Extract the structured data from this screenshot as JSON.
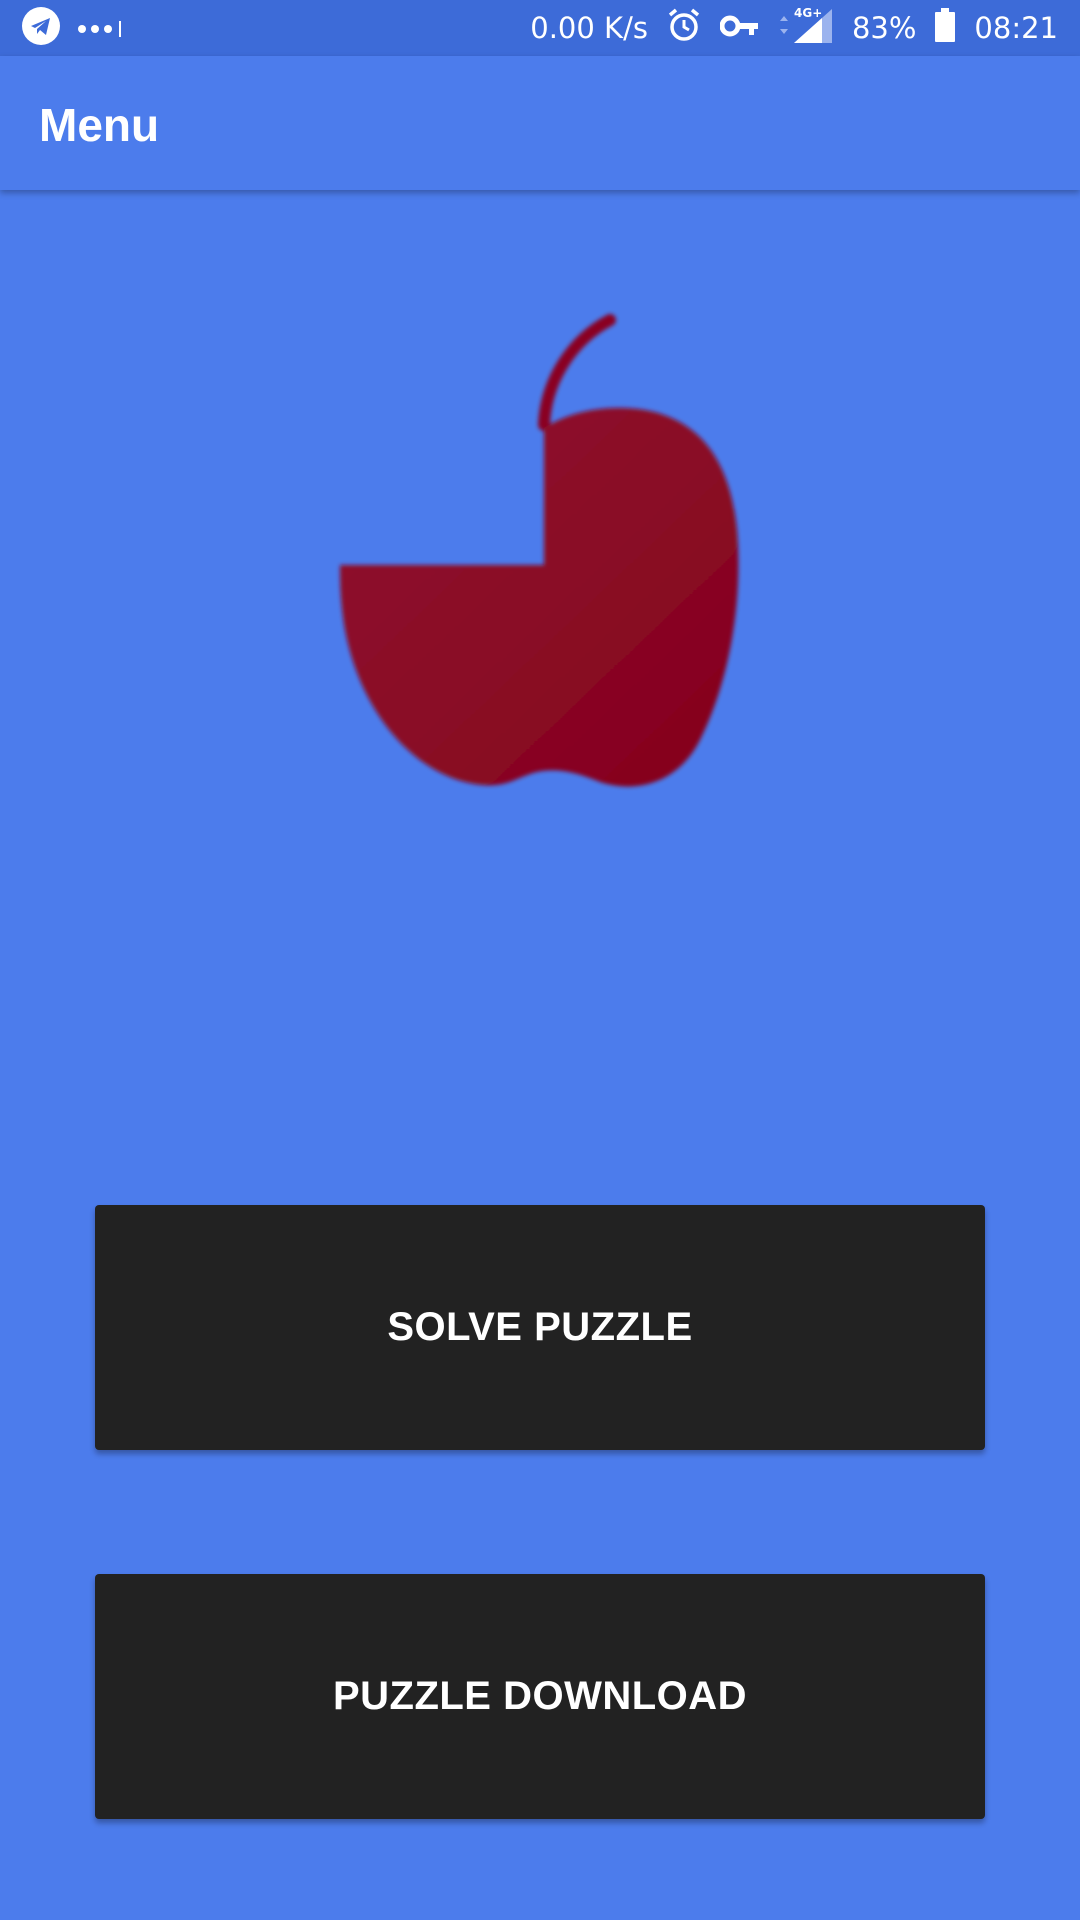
{
  "status_bar": {
    "icons_left": [
      "telegram-icon",
      "overflow-dots-icon"
    ],
    "net_speed": "0.00 K/s",
    "icons_right": [
      "alarm-icon",
      "vpn-key-icon",
      "signal-4g-icon",
      "battery-icon"
    ],
    "battery": "83%",
    "time": "08:21"
  },
  "app_bar": {
    "title": "Menu"
  },
  "logo": {
    "icon": "apple-puzzle-icon",
    "color": "#8a0020"
  },
  "buttons": {
    "solve": "SOLVE PUZZLE",
    "download": "PUZZLE DOWNLOAD"
  },
  "colors": {
    "background": "#4c7cec",
    "status_bar": "#3d6bd8",
    "button": "#222222"
  }
}
